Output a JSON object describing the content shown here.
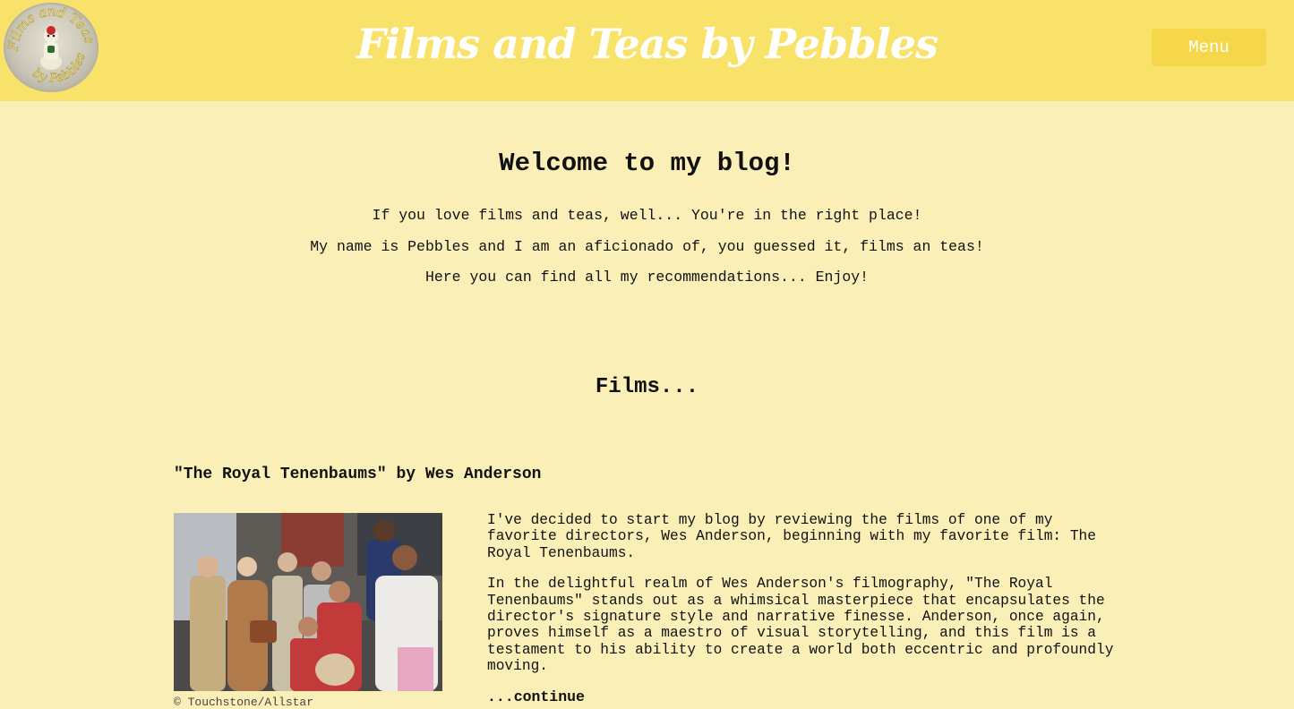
{
  "header": {
    "logo_alt": "Films and Teas by Pebbles",
    "title": "Films and Teas by Pebbles",
    "menu_label": "Menu"
  },
  "intro": {
    "heading": "Welcome to my blog!",
    "paragraphs": [
      "If you love films and teas, well... You're in the right place!",
      "My name is Pebbles and I am an aficionado of, you guessed it, films an teas!",
      "Here you can find all my recommendations... Enjoy!"
    ]
  },
  "films_section": {
    "heading": "Films...",
    "post": {
      "title": "\"The Royal Tenenbaums\" by Wes Anderson",
      "image_caption": "© Touchstone/Allstar",
      "paragraphs": [
        "I've decided to start my blog by reviewing the films of one of my favorite directors, Wes Anderson, beginning with my favorite film: The Royal Tenenbaums.",
        "In the delightful realm of Wes Anderson's filmography, \"The Royal Tenenbaums\" stands out as a whimsical masterpiece that encapsulates the director's signature style and narrative finesse. Anderson, once again, proves himself as a maestro of visual storytelling, and this film is a testament to his ability to create a world both eccentric and profoundly moving."
      ],
      "continue_label": "...continue"
    }
  },
  "colors": {
    "header_bg": "#f9e26a",
    "page_bg": "#fbefb8",
    "menu_bg": "#f5d749",
    "title_text": "#ffffff"
  }
}
